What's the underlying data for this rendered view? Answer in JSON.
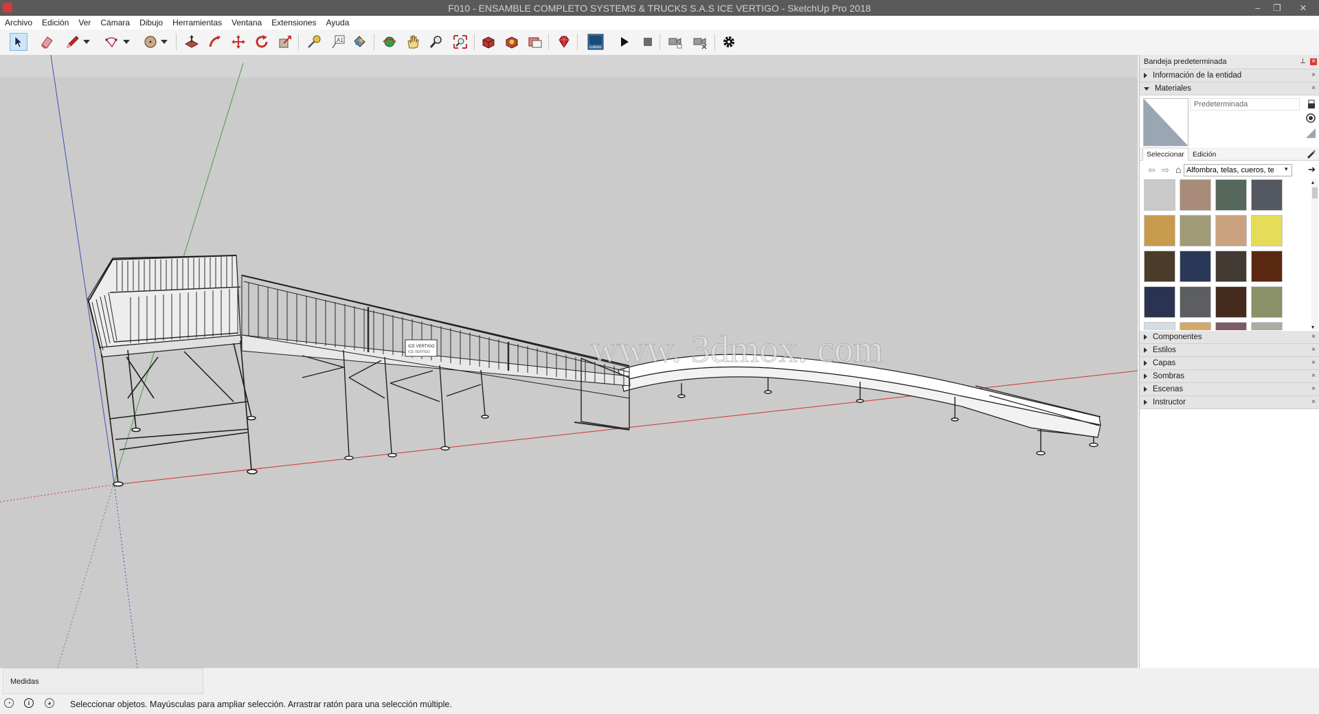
{
  "window": {
    "title": "F010 - ENSAMBLE COMPLETO SYSTEMS & TRUCKS S.A.S ICE VERTIGO - SketchUp Pro 2018"
  },
  "menu": [
    "Archivo",
    "Edición",
    "Ver",
    "Cámara",
    "Dibujo",
    "Herramientas",
    "Ventana",
    "Extensiones",
    "Ayuda"
  ],
  "toolbar_icons": [
    "select-icon",
    "eraser-icon",
    "pencil-icon",
    "pencil-dropdown-icon",
    "arc-icon",
    "arc-dropdown-icon",
    "circle-icon",
    "circle-dropdown-icon",
    "push-pull-icon",
    "follow-me-icon",
    "move-icon",
    "rotate-icon",
    "scale-icon",
    "tape-measure-icon",
    "text-icon",
    "paint-bucket-icon",
    "orbit-icon",
    "pan-icon",
    "zoom-icon",
    "zoom-extents-icon",
    "warehouse-icon",
    "extension-warehouse-icon",
    "layout-icon",
    "ruby-icon",
    "lumion-icon",
    "play-icon",
    "stop-icon",
    "camera-icon",
    "camera-x-icon",
    "settings-icon"
  ],
  "panel": {
    "title": "Bandeja predeterminada",
    "entity_info": "Información de la entidad",
    "materials": {
      "title": "Materiales",
      "current_name": "Predeterminada",
      "tab_select": "Seleccionar",
      "tab_edit": "Edición",
      "category": "Alfombra, telas, cueros, te",
      "swatch_colors": [
        "#c9c9c9",
        "#a88b78",
        "#55685b",
        "#545860",
        "#c79a4e",
        "#9e9b76",
        "#c9a27f",
        "#e5dd5a",
        "#4a3b2b",
        "#2a3858",
        "#433a34",
        "#5a2810",
        "#2a3452",
        "#5c5e62",
        "#452a1e",
        "#8a9168",
        "#d3dde3",
        "#d2aa6a",
        "#7e5a68",
        "#a8aea0",
        "#9c9e66",
        "#8c8890",
        "#e0b87c",
        "#ffffff"
      ]
    },
    "sections": [
      "Componentes",
      "Estilos",
      "Capas",
      "Sombras",
      "Escenas",
      "Instructor"
    ]
  },
  "viewport": {
    "watermark": "www. 3dmox. com",
    "sign_text": "ICE VERTIGO"
  },
  "status": {
    "measure_label": "Medidas",
    "message": "Seleccionar objetos. Mayúsculas para ampliar selección. Arrastrar ratón para una selección múltiple."
  }
}
